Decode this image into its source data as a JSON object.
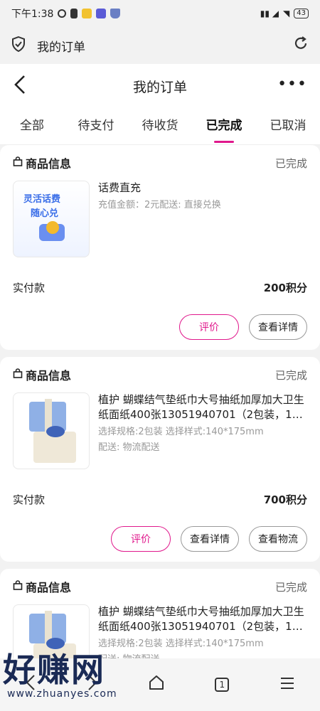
{
  "status_bar": {
    "time": "下午1:38",
    "battery": "43"
  },
  "browser": {
    "title": "我的订单"
  },
  "header": {
    "title": "我的订单",
    "more": "•••"
  },
  "tabs": [
    {
      "label": "全部"
    },
    {
      "label": "待支付"
    },
    {
      "label": "待收货"
    },
    {
      "label": "已完成"
    },
    {
      "label": "已取消"
    }
  ],
  "active_tab": "已完成",
  "orders": [
    {
      "section_title": "商品信息",
      "status": "已完成",
      "thumb_text_1": "灵活话费",
      "thumb_text_2": "随心兑",
      "name": "话费直充",
      "spec": "充值金额：2元配送: 直接兑换",
      "delivery": "",
      "pay_label": "实付款",
      "pay_value": "200积分",
      "buttons": [
        "评价",
        "查看详情"
      ]
    },
    {
      "section_title": "商品信息",
      "status": "已完成",
      "name": "植护 蝴蝶结气垫纸巾大号抽纸加厚加大卫生纸面纸400张13051940701（2包装，1…",
      "spec": "选择规格:2包装 选择样式:140*175mm",
      "delivery": "配送: 物流配送",
      "pay_label": "实付款",
      "pay_value": "700积分",
      "buttons": [
        "评价",
        "查看详情",
        "查看物流"
      ]
    },
    {
      "section_title": "商品信息",
      "status": "已完成",
      "name": "植护 蝴蝶结气垫纸巾大号抽纸加厚加大卫生纸面纸400张13051940701（2包装，1…",
      "spec": "选择规格:2包装 选择样式:140*175mm",
      "delivery": "配送: 物流配送"
    }
  ],
  "bottom_nav": {
    "tab_count": "1"
  },
  "watermark": {
    "text": "好赚网",
    "url": "www.zhuanyes.com"
  },
  "colors": {
    "accent": "#e0188c",
    "background": "#f2f2f2"
  }
}
